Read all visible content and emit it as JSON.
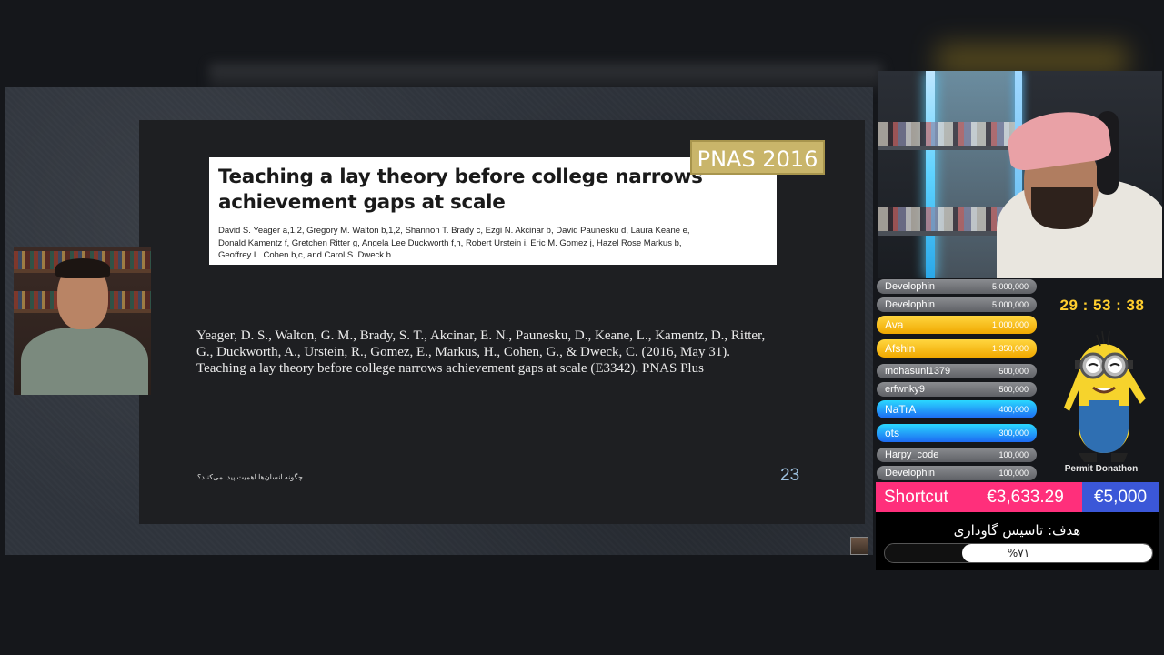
{
  "slide": {
    "badge": "PNAS 2016",
    "paper_title_line1": "Teaching a lay theory before college narrows",
    "paper_title_line2": "achievement gaps at scale",
    "authors": [
      "David S. Yeager a,1,2, Gregory M. Walton b,1,2, Shannon T. Brady c, Ezgi N. Akcinar b, David Paunesku d, Laura Keane e,",
      "Donald Kamentz f, Gretchen Ritter g, Angela Lee Duckworth f,h, Robert Urstein i, Eric M. Gomez j, Hazel Rose Markus b,",
      "Geoffrey L. Cohen b,c, and Carol S. Dweck b"
    ],
    "citation_lines": [
      "Yeager, D. S., Walton, G. M., Brady, S. T., Akcinar, E. N., Paunesku, D., Keane, L., Kamentz, D., Ritter,",
      "G., Duckworth, A., Urstein, R., Gomez, E., Markus, H., Cohen, G., & Dweck, C. (2016, May 31).",
      "Teaching a lay theory before college narrows achievement gaps at scale (E3342). PNAS Plus"
    ],
    "footer_text": "چگونه انسان‌ها اهمیت پیدا می‌کنند؟",
    "page_number": "23"
  },
  "donations": [
    {
      "name": "Develophin",
      "amount": "5,000,000",
      "style": "gray"
    },
    {
      "name": "Develophin",
      "amount": "5,000,000",
      "style": "gray"
    },
    {
      "name": "Ava",
      "amount": "1,000,000",
      "style": "gold"
    },
    {
      "name": "Afshin",
      "amount": "1,350,000",
      "style": "gold"
    },
    {
      "name": "mohasuni1379",
      "amount": "500,000",
      "style": "gray"
    },
    {
      "name": "erfwnky9",
      "amount": "500,000",
      "style": "gray"
    },
    {
      "name": "NaTrA",
      "amount": "400,000",
      "style": "blue"
    },
    {
      "name": "ots",
      "amount": "300,000",
      "style": "blue"
    },
    {
      "name": "Harpy_code",
      "amount": "100,000",
      "style": "gray"
    },
    {
      "name": "Develophin",
      "amount": "100,000",
      "style": "gray"
    }
  ],
  "timer": "29 : 53 : 38",
  "subathon_label": "Permit Donathon",
  "shortcut": {
    "label": "Shortcut",
    "current": "€3,633.29",
    "goal": "€5,000"
  },
  "goal": {
    "title": "هدف: تاسیس گاوداری",
    "progress_label": "%۷۱",
    "progress_fraction": 0.71
  },
  "colors": {
    "badge": "#c9b56a",
    "timer": "#ffce2e",
    "shortcut_pink": "#ff2f7b",
    "shortcut_blue": "#3b57d8",
    "page_number": "#9ec1df"
  }
}
